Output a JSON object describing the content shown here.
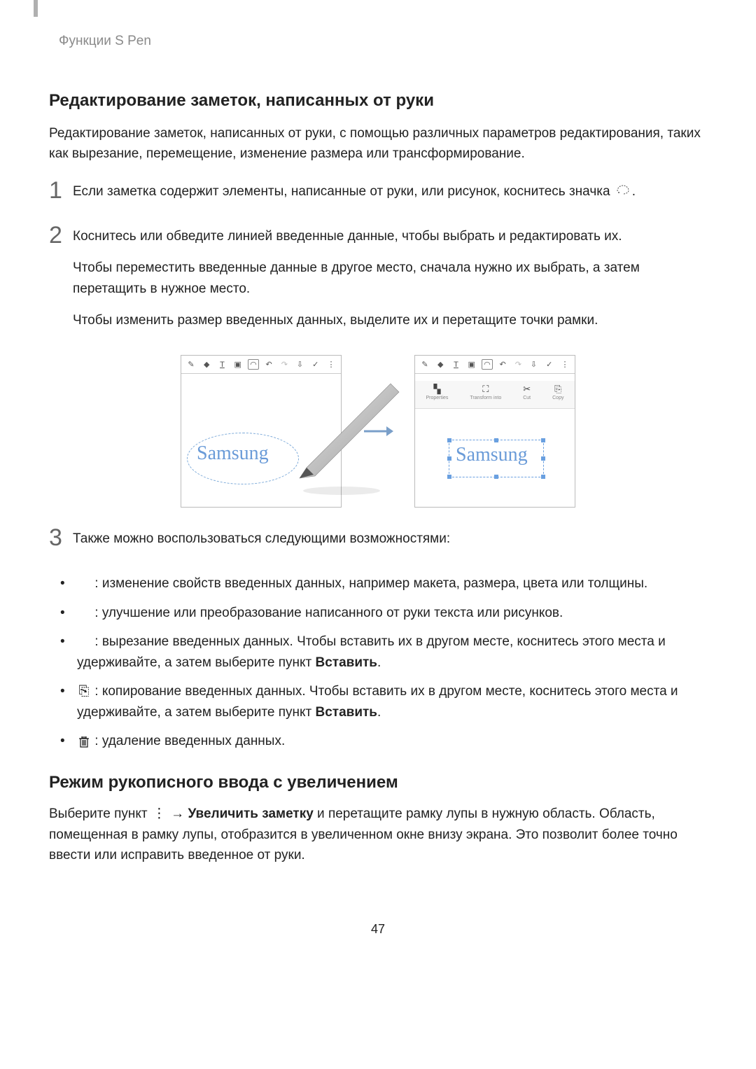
{
  "header": {
    "breadcrumb": "Функции S Pen"
  },
  "section1": {
    "title": "Редактирование заметок, написанных от руки",
    "intro": "Редактирование заметок, написанных от руки, с помощью различных параметров редактирования, таких как вырезание, перемещение, изменение размера или трансформирование.",
    "steps": {
      "s1": {
        "num": "1",
        "text": "Если заметка содержит элементы, написанные от руки, или рисунок, коснитесь значка "
      },
      "s2": {
        "num": "2",
        "p1": "Коснитесь или обведите линией введенные данные, чтобы выбрать и редактировать их.",
        "p2": "Чтобы переместить введенные данные в другое место, сначала нужно их выбрать, а затем перетащить в нужное место.",
        "p3": "Чтобы изменить размер введенных данных, выделите их и перетащите точки рамки."
      },
      "s3": {
        "num": "3",
        "text": "Также можно воспользоваться следующими возможностями:"
      }
    },
    "figure": {
      "handwriting": "Samsung",
      "context": {
        "properties": "Properties",
        "transform": "Transform into",
        "cut": "Cut",
        "copy": "Copy"
      }
    },
    "bullets": {
      "b1": " : изменение свойств введенных данных, например макета, размера, цвета или толщины.",
      "b2": " : улучшение или преобразование написанного от руки текста или рисунков.",
      "b3_pre": " : вырезание введенных данных. Чтобы вставить их в другом месте, коснитесь этого места и удерживайте, а затем выберите пункт ",
      "b3_bold": "Вставить",
      "b3_post": ".",
      "b4_pre": " : копирование введенных данных. Чтобы вставить их в другом месте, коснитесь этого места и удерживайте, а затем выберите пункт ",
      "b4_bold": "Вставить",
      "b4_post": ".",
      "b5": " : удаление введенных данных."
    }
  },
  "section2": {
    "title": "Режим рукописного ввода с увеличением",
    "p_pre": "Выберите пункт ",
    "p_mid": " → ",
    "p_bold": "Увеличить заметку",
    "p_post": " и перетащите рамку лупы в нужную область. Область, помещенная в рамку лупы, отобразится в увеличенном окне внизу экрана. Это позволит более точно ввести или исправить введенное от руки."
  },
  "page_number": "47"
}
